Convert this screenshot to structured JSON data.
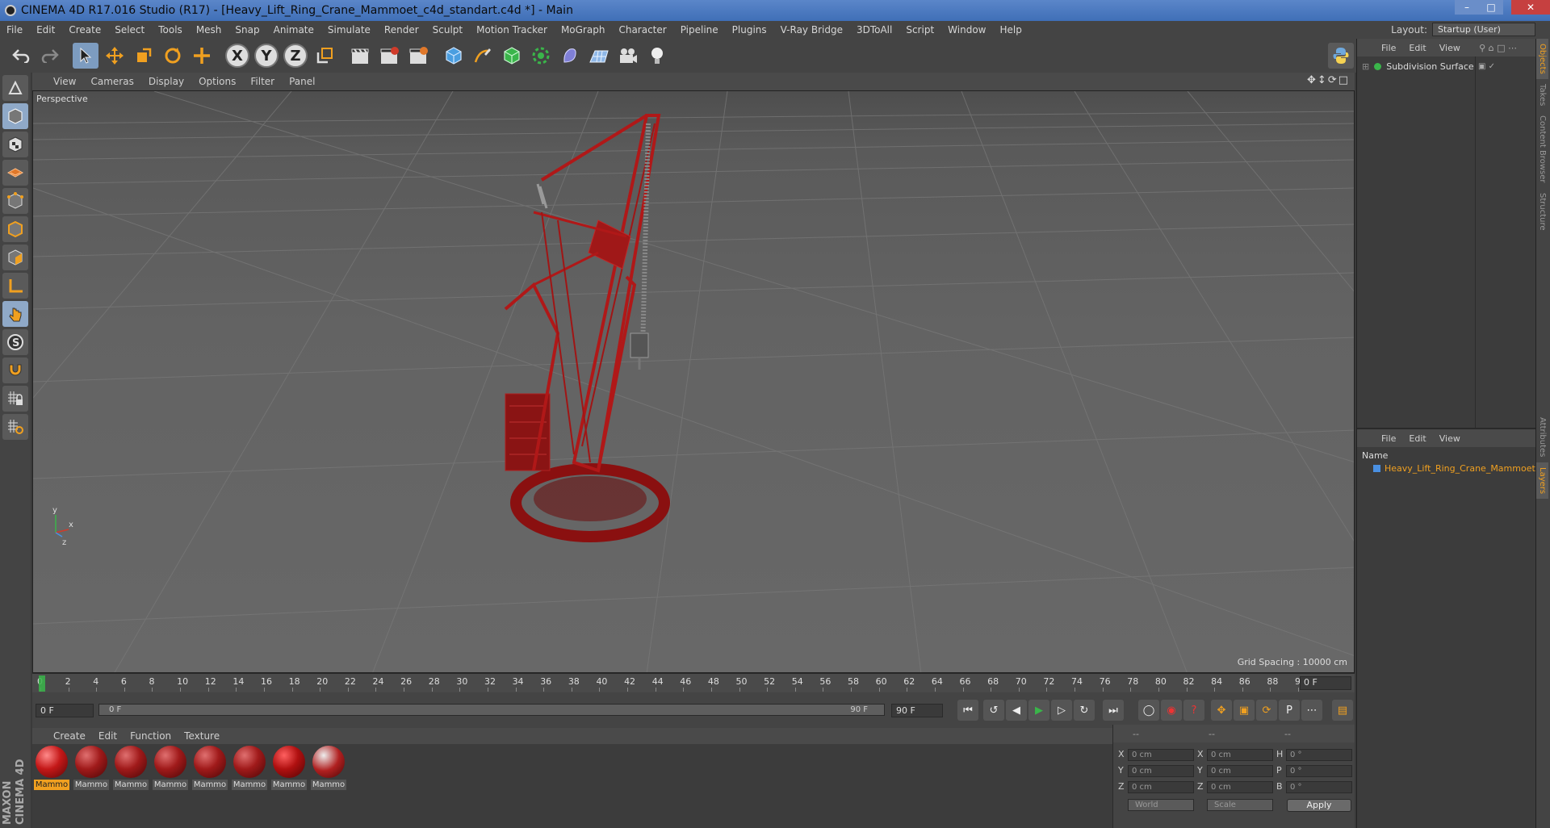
{
  "window": {
    "title": "CINEMA 4D R17.016 Studio (R17) - [Heavy_Lift_Ring_Crane_Mammoet_c4d_standart.c4d *] - Main"
  },
  "menubar": {
    "items": [
      "File",
      "Edit",
      "Create",
      "Select",
      "Tools",
      "Mesh",
      "Snap",
      "Animate",
      "Simulate",
      "Render",
      "Sculpt",
      "Motion Tracker",
      "MoGraph",
      "Character",
      "Pipeline",
      "Plugins",
      "V-Ray Bridge",
      "3DToAll",
      "Script",
      "Window",
      "Help"
    ],
    "layout_label": "Layout:",
    "layout_value": "Startup (User)"
  },
  "toolbar": {
    "axis_x": "X",
    "axis_y": "Y",
    "axis_z": "Z"
  },
  "viewport": {
    "menu": [
      "View",
      "Cameras",
      "Display",
      "Options",
      "Filter",
      "Panel"
    ],
    "camera_label": "Perspective",
    "grid_spacing": "Grid Spacing : 10000 cm",
    "axis_y": "y",
    "axis_x": "x",
    "axis_z": "z"
  },
  "timeline": {
    "ticks": [
      "0",
      "2",
      "4",
      "6",
      "8",
      "10",
      "12",
      "14",
      "16",
      "18",
      "20",
      "22",
      "24",
      "26",
      "28",
      "30",
      "32",
      "34",
      "36",
      "38",
      "40",
      "42",
      "44",
      "46",
      "48",
      "50",
      "52",
      "54",
      "56",
      "58",
      "60",
      "62",
      "64",
      "66",
      "68",
      "70",
      "72",
      "74",
      "76",
      "78",
      "80",
      "82",
      "84",
      "86",
      "88",
      "90"
    ],
    "current_frame": "0 F"
  },
  "transport": {
    "start_field": "0 F",
    "range_start": "0 F",
    "range_end": "90 F",
    "end_field": "90 F"
  },
  "materials": {
    "menu": [
      "Create",
      "Edit",
      "Function",
      "Texture"
    ],
    "items": [
      "Mammo",
      "Mammo",
      "Mammo",
      "Mammo",
      "Mammo",
      "Mammo",
      "Mammo",
      "Mammo"
    ]
  },
  "coordinates": {
    "head": [
      "--",
      "--",
      "--"
    ],
    "labels_pos": [
      "X",
      "Y",
      "Z"
    ],
    "labels_size": [
      "X",
      "Y",
      "Z"
    ],
    "labels_rot": [
      "H",
      "P",
      "B"
    ],
    "pos_values": [
      "0 cm",
      "0 cm",
      "0 cm"
    ],
    "size_values": [
      "0 cm",
      "0 cm",
      "0 cm"
    ],
    "rot_values": [
      "0 °",
      "0 °",
      "0 °"
    ],
    "coord_system": "World",
    "mode": "Scale",
    "apply": "Apply"
  },
  "object_manager": {
    "menu": [
      "File",
      "Edit",
      "View"
    ],
    "object_name": "Subdivision Surface"
  },
  "layer_manager": {
    "menu": [
      "File",
      "Edit",
      "View"
    ],
    "column_name": "Name",
    "layer_name": "Heavy_Lift_Ring_Crane_Mammoet"
  },
  "side_tabs": [
    "Objects",
    "Takes",
    "Content Browser",
    "Structure",
    "Attributes",
    "Layers"
  ],
  "branding": "MAXON CINEMA 4D"
}
